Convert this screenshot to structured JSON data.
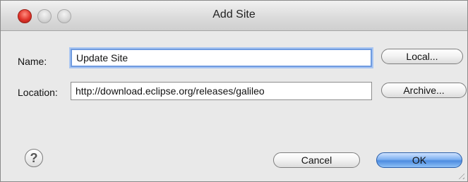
{
  "window": {
    "title": "Add Site"
  },
  "form": {
    "name_label": "Name:",
    "name_value": "Update Site",
    "location_label": "Location:",
    "location_value": "http://download.eclipse.org/releases/galileo"
  },
  "buttons": {
    "local": "Local...",
    "archive": "Archive...",
    "cancel": "Cancel",
    "ok": "OK",
    "help": "?"
  },
  "colors": {
    "close_button": "#e0332a",
    "default_button": "#4d8ce0",
    "focus_ring": "#6f9be0"
  }
}
